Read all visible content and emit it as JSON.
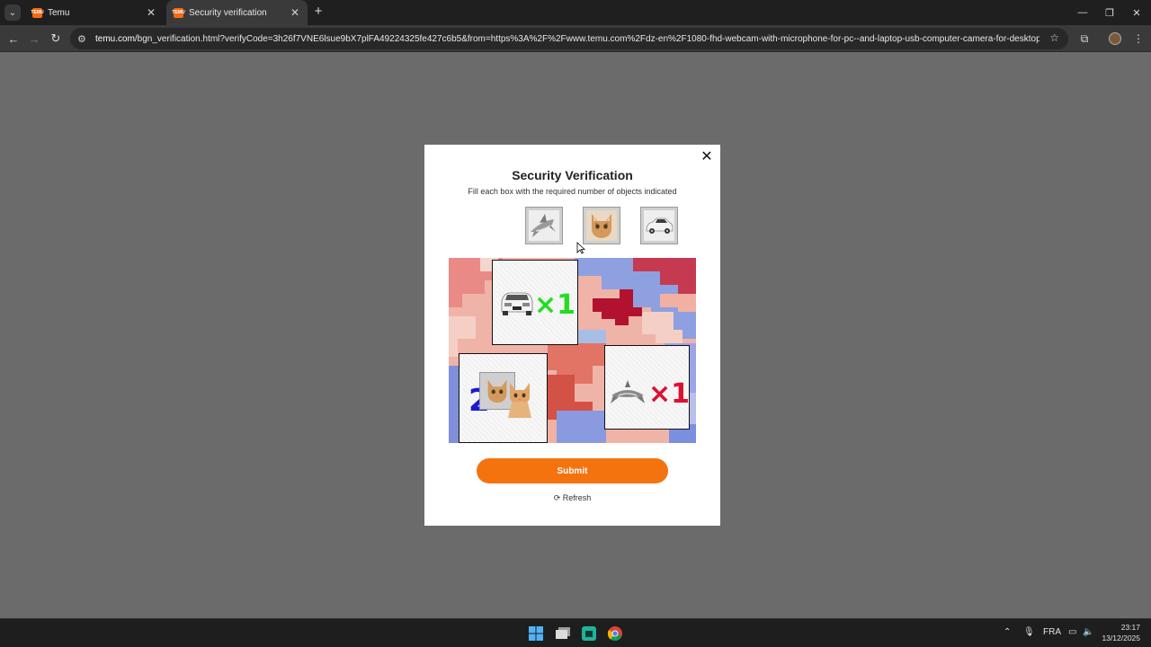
{
  "browser": {
    "tabs": [
      {
        "favicon_text": "TEMU",
        "title": "Temu"
      },
      {
        "favicon_text": "TEMU",
        "title": "Security verification"
      }
    ],
    "url_host": "temu.com",
    "url_path": "/bgn_verification.html?verifyCode=3h26f7VNE6lsue9bX7plFA49224325fe427c6b5&from=https%3A%2F%2Fwww.temu.com%2Fdz-en%2F1080-fhd-webcam-with-microphone-for-pc--and-laptop-usb-computer-camera-for-desktop-streaming-an..."
  },
  "modal": {
    "title": "Security Verification",
    "subtitle": "Fill each box with the required number of objects indicated",
    "options": [
      {
        "icon": "shark-icon"
      },
      {
        "icon": "cat-icon"
      },
      {
        "icon": "car-icon"
      }
    ],
    "boxes": [
      {
        "icon": "car-icon",
        "multiplier": "×1",
        "color": "#22dd22"
      },
      {
        "icon": "cat-icon",
        "multiplier": "2×",
        "color": "#1a1ad6"
      },
      {
        "icon": "shark-icon",
        "multiplier": "×1",
        "color": "#dd1030"
      }
    ],
    "submit_label": "Submit",
    "refresh_label": "Refresh"
  },
  "taskbar": {
    "language": "FRA",
    "time": "23:17",
    "date": "13/12/2025"
  },
  "colors": {
    "accent": "#f5730f",
    "backdrop": "#6b6b6b",
    "brand": "#f56a12"
  }
}
